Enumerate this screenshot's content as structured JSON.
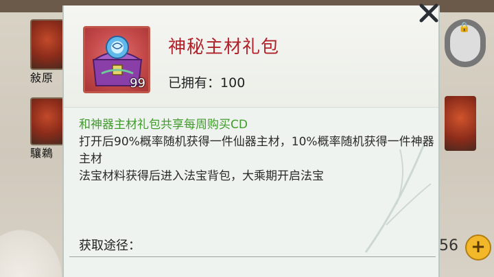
{
  "item": {
    "name": "神秘主材礼包",
    "count": "99",
    "owned_label": "已拥有：",
    "owned_value": "100",
    "icon": "treasure-chest-icon"
  },
  "description": {
    "shared_cd": "和神器主材礼包共享每周购买CD",
    "effect": "打开后90%概率随机获得一件仙器主材，10%概率随机获得一件神器主材",
    "note": "法宝材料获得后进入法宝背包，大乘期开启法宝"
  },
  "source": {
    "label": "获取途径："
  },
  "background": {
    "currency_value": "56",
    "slot_labels": [
      "敍原",
      "驤鵜"
    ]
  },
  "colors": {
    "item_name": "#b0222a",
    "shared_cd": "#3f9b2a",
    "frame": "#c0564a"
  }
}
